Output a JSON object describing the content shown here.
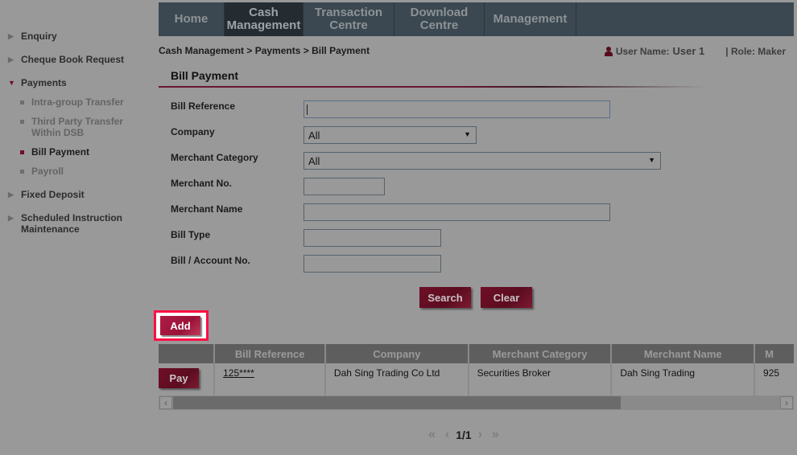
{
  "nav": {
    "tabs": [
      {
        "label": "Home"
      },
      {
        "label": "Cash\nManagement",
        "line1": "Cash",
        "line2": "Management",
        "active": true
      },
      {
        "label": "Transaction Centre",
        "line1": "Transaction",
        "line2": "Centre"
      },
      {
        "label": "Download Centre",
        "line1": "Download",
        "line2": "Centre"
      },
      {
        "label": "Management"
      }
    ]
  },
  "sidebar": {
    "items": [
      {
        "label": "Enquiry",
        "expanded": false
      },
      {
        "label": "Cheque Book Request",
        "expanded": false
      },
      {
        "label": "Payments",
        "expanded": true,
        "children": [
          {
            "label": "Intra-group Transfer"
          },
          {
            "label": "Third Party Transfer Within DSB",
            "line1": "Third Party Transfer",
            "line2": "Within DSB"
          },
          {
            "label": "Bill Payment",
            "active": true
          },
          {
            "label": "Payroll"
          }
        ]
      },
      {
        "label": "Fixed Deposit",
        "expanded": false
      },
      {
        "label": "Scheduled Instruction Maintenance",
        "line1": "Scheduled Instruction",
        "line2": "Maintenance",
        "expanded": false
      }
    ]
  },
  "breadcrumb": "Cash Management > Payments > Bill Payment",
  "user": {
    "name_label": "User Name:",
    "name_value": "User 1",
    "role": "| Role: Maker"
  },
  "section_title": "Bill Payment",
  "form": {
    "fields": [
      {
        "label": "Bill Reference",
        "value": ""
      },
      {
        "label": "Company",
        "value": "All"
      },
      {
        "label": "Merchant Category",
        "value": "All"
      },
      {
        "label": "Merchant No.",
        "value": ""
      },
      {
        "label": "Merchant Name",
        "value": ""
      },
      {
        "label": "Bill Type",
        "value": ""
      },
      {
        "label": "Bill / Account No.",
        "value": ""
      }
    ],
    "search_label": "Search",
    "clear_label": "Clear"
  },
  "add_label": "Add",
  "table": {
    "columns": [
      "",
      "Bill Reference",
      "Company",
      "Merchant Category",
      "Merchant Name",
      "M"
    ],
    "rows": [
      {
        "action": "Pay",
        "bill_reference": "125****",
        "company": "Dah Sing Trading Co Ltd",
        "merchant_category": "Securities Broker",
        "merchant_name": "Dah Sing Trading",
        "merchant_no": "925"
      }
    ]
  },
  "pagination": {
    "current": "1/1"
  },
  "colors": {
    "nav_bg": "#3b4851",
    "brand_maroon": "#6d0f24",
    "highlight_border": "#ff1044"
  }
}
